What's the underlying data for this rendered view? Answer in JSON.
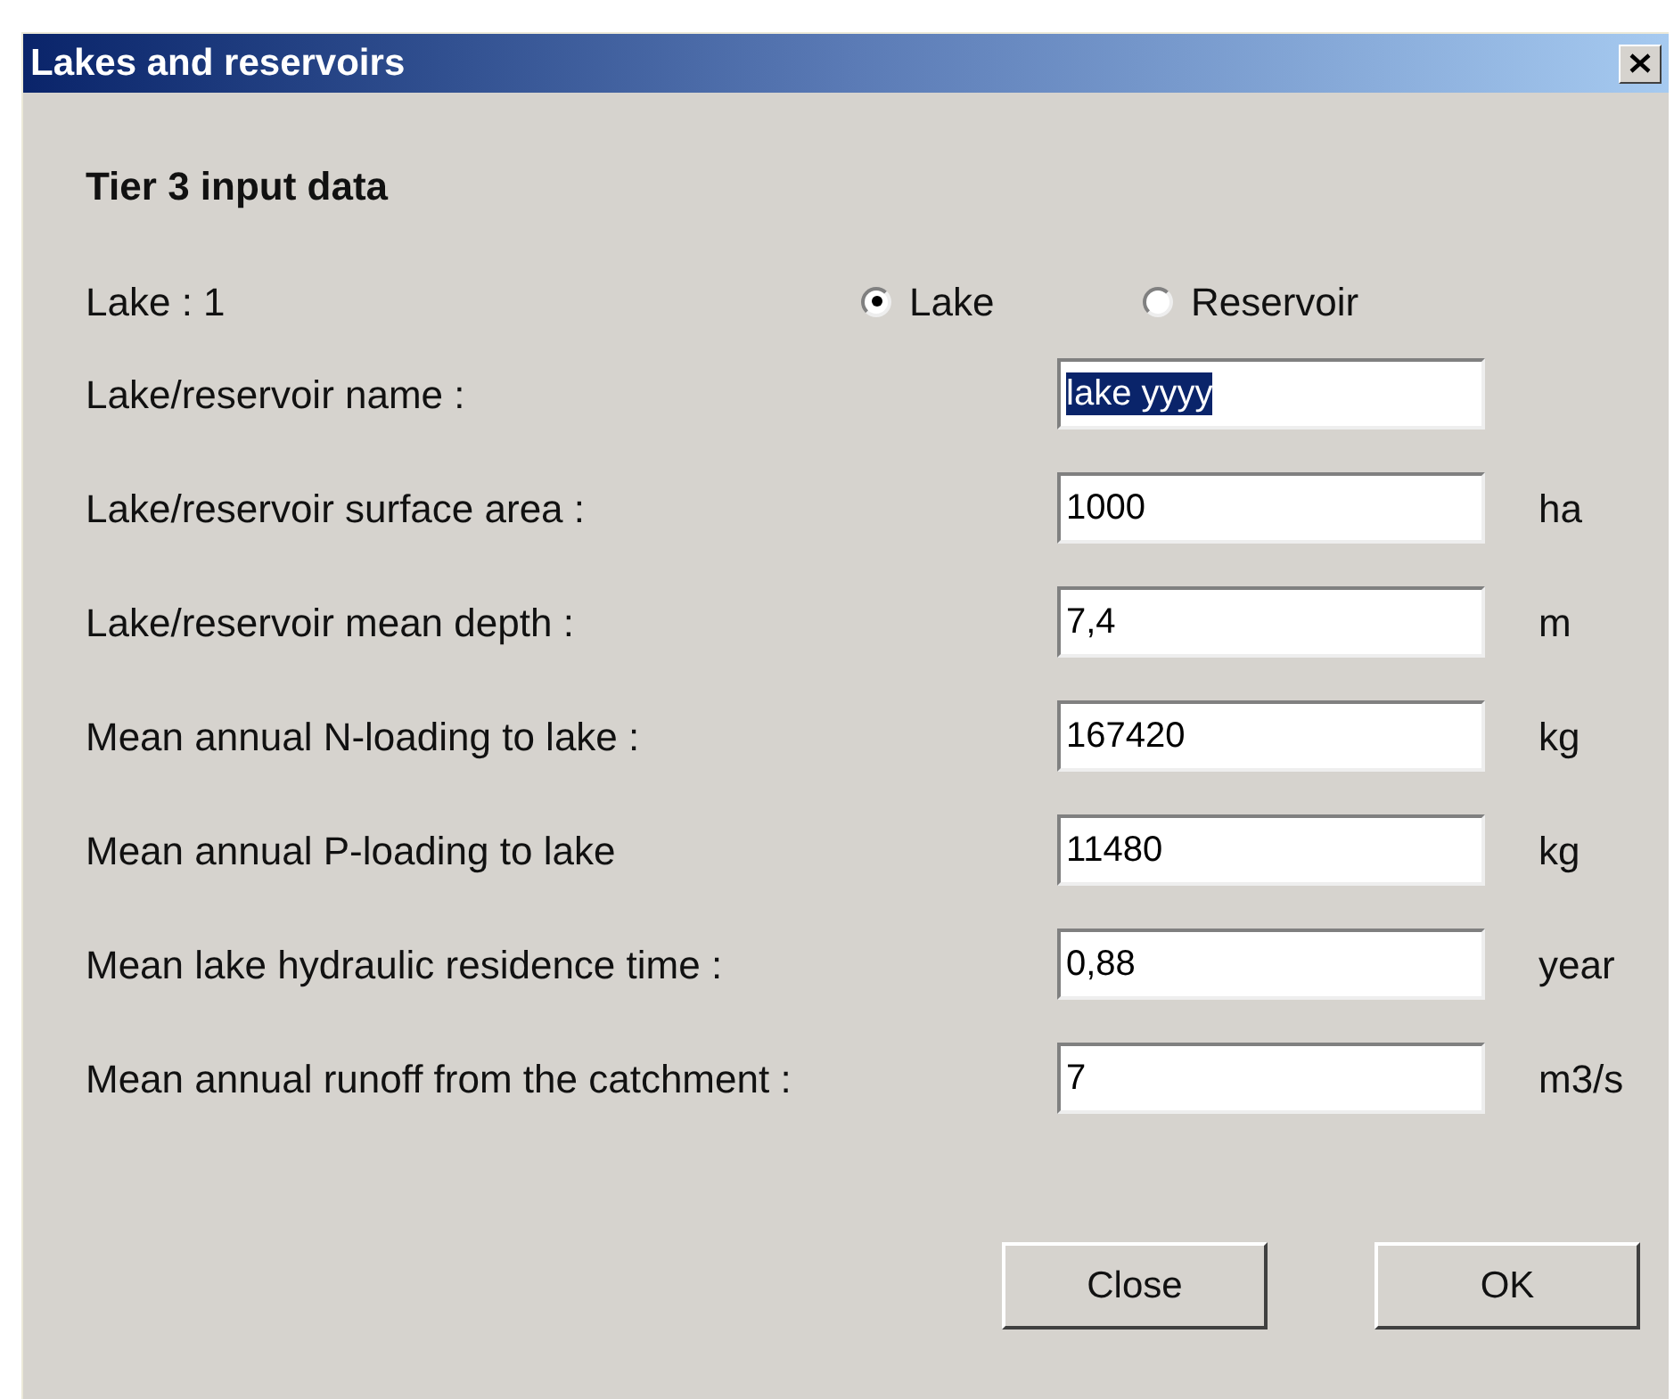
{
  "window": {
    "title": "Lakes and reservoirs"
  },
  "heading": "Tier 3 input data",
  "lake_label": "Lake : 1",
  "type_options": [
    {
      "label": "Lake",
      "selected": true
    },
    {
      "label": "Reservoir",
      "selected": false
    }
  ],
  "fields": [
    {
      "label": "Lake/reservoir name :",
      "value": "lake yyyy",
      "text_selected": true
    },
    {
      "label": "Lake/reservoir surface area :",
      "value": "1000",
      "unit": "ha",
      "text_selected": false
    },
    {
      "label": "Lake/reservoir mean depth :",
      "value": "7,4",
      "unit": "m",
      "text_selected": false
    },
    {
      "label": "Mean annual N-loading to lake :",
      "value": "167420",
      "unit": "kg",
      "text_selected": false
    },
    {
      "label": "Mean annual P-loading to lake",
      "value": "11480",
      "unit": "kg",
      "text_selected": false
    },
    {
      "label": "Mean lake hydraulic residence time :",
      "value": "0,88",
      "unit": "year",
      "text_selected": false
    },
    {
      "label": "Mean annual runoff from the catchment :",
      "value": "7",
      "unit": "m3/s",
      "text_selected": false
    }
  ],
  "buttons": [
    "Close",
    "OK"
  ]
}
